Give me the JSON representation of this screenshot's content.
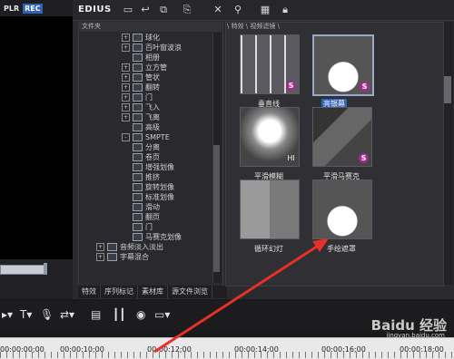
{
  "player": {
    "plr_label": "PLR",
    "rec_label": "REC",
    "close_label": "✕"
  },
  "app": {
    "title": "EDIUS"
  },
  "toolbar": {
    "icons": [
      "folder-icon",
      "return-icon",
      "copy-icon",
      "paste-icon",
      "delete-icon",
      "find-icon",
      "view-icon",
      "lock-icon"
    ],
    "close_label": "✕"
  },
  "tree": {
    "header": "文件夹",
    "items": [
      {
        "label": "球化",
        "expand": "+"
      },
      {
        "label": "百叶窗波浪",
        "expand": "+"
      },
      {
        "label": "相册",
        "expand": ""
      },
      {
        "label": "立方管",
        "expand": "+"
      },
      {
        "label": "管状",
        "expand": "+"
      },
      {
        "label": "翻转",
        "expand": "+"
      },
      {
        "label": "门",
        "expand": "+"
      },
      {
        "label": "飞入",
        "expand": "+"
      },
      {
        "label": "飞离",
        "expand": "+"
      },
      {
        "label": "高级",
        "expand": ""
      },
      {
        "label": "SMPTE",
        "expand": "-"
      },
      {
        "label": "分离",
        "expand": ""
      },
      {
        "label": "卷页",
        "expand": ""
      },
      {
        "label": "增强划像",
        "expand": ""
      },
      {
        "label": "推挤",
        "expand": ""
      },
      {
        "label": "旋转划像",
        "expand": ""
      },
      {
        "label": "标准划像",
        "expand": ""
      },
      {
        "label": "滑动",
        "expand": ""
      },
      {
        "label": "翻页",
        "expand": ""
      },
      {
        "label": "门",
        "expand": ""
      },
      {
        "label": "马赛克划像",
        "expand": ""
      },
      {
        "label": "音频淡入淡出",
        "expand": "+"
      },
      {
        "label": "字幕混合",
        "expand": "+"
      }
    ]
  },
  "tabs": [
    "特效",
    "序列标记",
    "素材库",
    "源文件浏览"
  ],
  "effects": {
    "path": "\\ 特效 \\ 视频滤镜 \\",
    "items": [
      {
        "label": "垂直线",
        "selected": false,
        "badge": "S"
      },
      {
        "label": "亮银幕",
        "selected": true,
        "badge": "S"
      },
      {
        "label": "平滑模糊",
        "selected": false,
        "badge": "HI"
      },
      {
        "label": "平滑马赛克",
        "selected": false,
        "badge": "S"
      },
      {
        "label": "循环幻灯",
        "selected": false,
        "badge": ""
      },
      {
        "label": "手绘遮罩",
        "selected": false,
        "badge": ""
      }
    ]
  },
  "timeline": {
    "ticks": [
      "00:00:00;00",
      "00:00:10;00",
      "00:00:12;00",
      "00:00:14;00",
      "00:00:16;00",
      "00:00:18;00"
    ]
  },
  "watermark": {
    "main": "Baidu 经验",
    "sub": "jingyan.baidu.com"
  }
}
